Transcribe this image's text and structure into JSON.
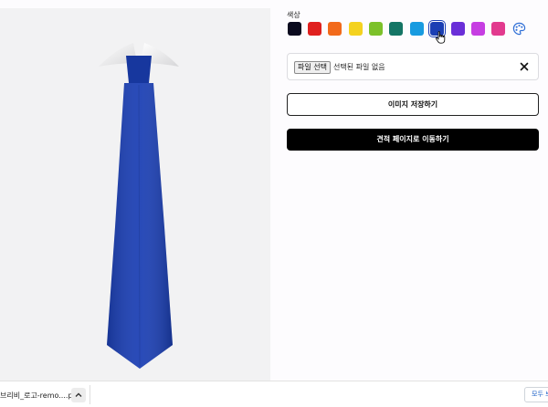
{
  "colors": {
    "label": "색상",
    "swatches": [
      {
        "name": "black",
        "hex": "#0a0a1e"
      },
      {
        "name": "red",
        "hex": "#e0201e"
      },
      {
        "name": "orange",
        "hex": "#f26a1b"
      },
      {
        "name": "yellow",
        "hex": "#f4d21f"
      },
      {
        "name": "lime",
        "hex": "#7cc12a"
      },
      {
        "name": "teal",
        "hex": "#147565"
      },
      {
        "name": "sky",
        "hex": "#189be0"
      },
      {
        "name": "royal-blue",
        "hex": "#1b3fb4"
      },
      {
        "name": "violet",
        "hex": "#6a2fd8"
      },
      {
        "name": "magenta",
        "hex": "#c63ee2"
      },
      {
        "name": "pink",
        "hex": "#e23a8e"
      }
    ],
    "selected": "royal-blue",
    "custom_icon": "palette-icon"
  },
  "preview": {
    "tie_color": "#1b3fb4"
  },
  "file": {
    "button_label": "파일 선택",
    "status": "선택된 파일 없음"
  },
  "actions": {
    "save_label": "이미지 저장하기",
    "quote_label": "견적 페이지로 이동하기"
  },
  "downloads": {
    "filename": "브리비_로고-remo....png",
    "show_all": "모두 보기"
  }
}
